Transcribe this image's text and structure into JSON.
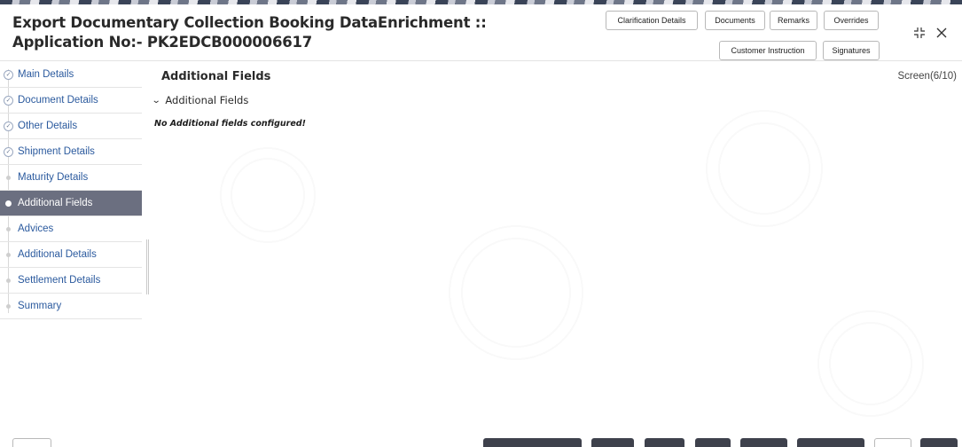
{
  "header": {
    "title": "Export Documentary Collection Booking DataEnrichment :: Application No:- PK2EDCB000006617",
    "buttons": {
      "clarification_details": "Clarification Details",
      "documents": "Documents",
      "remarks": "Remarks",
      "overrides": "Overrides",
      "customer_instruction": "Customer Instruction",
      "signatures": "Signatures"
    },
    "icons": {
      "minimize": "collapse-icon",
      "close": "close-icon"
    }
  },
  "sidebar": {
    "items": [
      {
        "label": "Main Details",
        "state": "completed"
      },
      {
        "label": "Document Details",
        "state": "completed"
      },
      {
        "label": "Other Details",
        "state": "completed"
      },
      {
        "label": "Shipment Details",
        "state": "completed"
      },
      {
        "label": "Maturity Details",
        "state": "pending"
      },
      {
        "label": "Additional Fields",
        "state": "active"
      },
      {
        "label": "Advices",
        "state": "pending"
      },
      {
        "label": "Additional Details",
        "state": "pending"
      },
      {
        "label": "Settlement Details",
        "state": "pending"
      },
      {
        "label": "Summary",
        "state": "pending"
      }
    ]
  },
  "main": {
    "title": "Additional Fields",
    "screen_indicator": "Screen(6/10)",
    "subsection_title": "Additional Fields",
    "empty_message": "No Additional fields configured!"
  },
  "colors": {
    "active_nav_bg": "#6b6f80",
    "nav_link": "#2b5a9e",
    "footer_button_dark": "#3e414c"
  }
}
